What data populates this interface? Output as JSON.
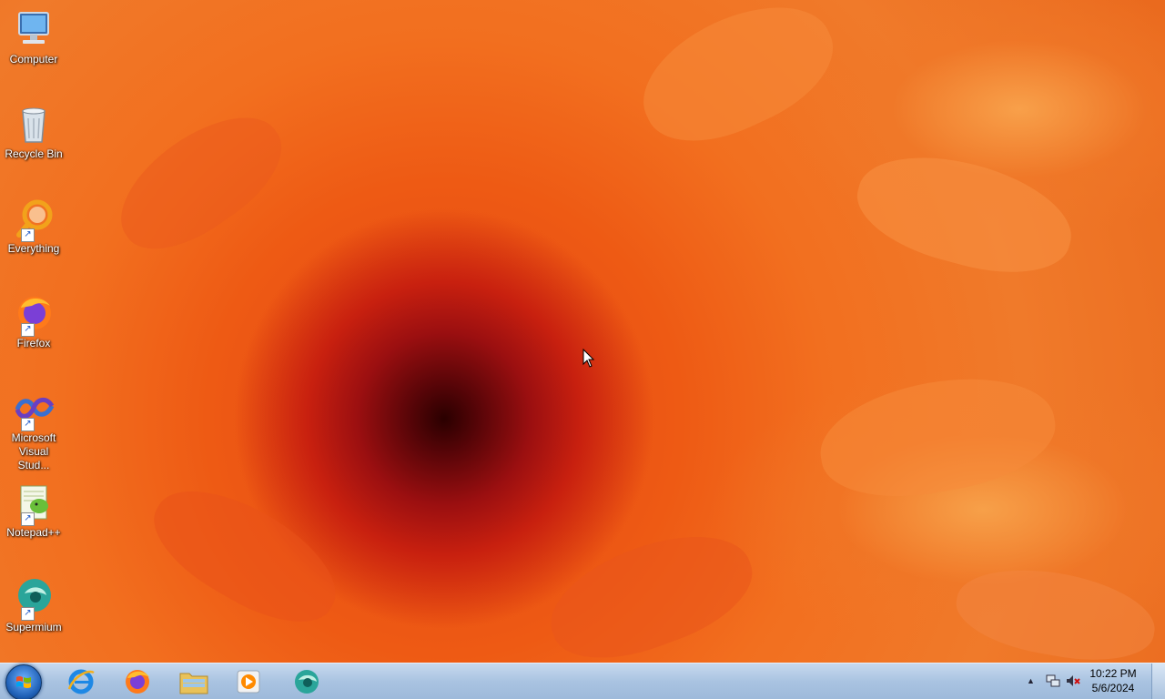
{
  "desktop_icons": [
    {
      "id": "computer",
      "label": "Computer",
      "icon": "computer-icon",
      "shortcut": false
    },
    {
      "id": "recycle-bin",
      "label": "Recycle Bin",
      "icon": "recycle-bin-icon",
      "shortcut": false
    },
    {
      "id": "everything",
      "label": "Everything",
      "icon": "everything-icon",
      "shortcut": true
    },
    {
      "id": "firefox",
      "label": "Firefox",
      "icon": "firefox-icon",
      "shortcut": true
    },
    {
      "id": "visual-studio",
      "label": "Microsoft\nVisual Stud...",
      "icon": "visual-studio-icon",
      "shortcut": true
    },
    {
      "id": "notepadpp",
      "label": "Notepad++",
      "icon": "notepadpp-icon",
      "shortcut": true
    },
    {
      "id": "supermium",
      "label": "Supermium",
      "icon": "supermium-icon",
      "shortcut": true
    }
  ],
  "taskbar": {
    "pinned": [
      {
        "id": "internet-explorer",
        "icon": "internet-explorer-icon"
      },
      {
        "id": "firefox",
        "icon": "firefox-icon"
      },
      {
        "id": "file-explorer",
        "icon": "folder-icon"
      },
      {
        "id": "media-player",
        "icon": "media-player-icon"
      },
      {
        "id": "supermium",
        "icon": "supermium-icon"
      }
    ],
    "tray": {
      "show_hidden_icon": "▲",
      "time": "10:22 PM",
      "date": "5/6/2024"
    }
  },
  "colors": {
    "taskbar": "#a9c3e1",
    "wallpaper_accent": "#ee5a14"
  }
}
